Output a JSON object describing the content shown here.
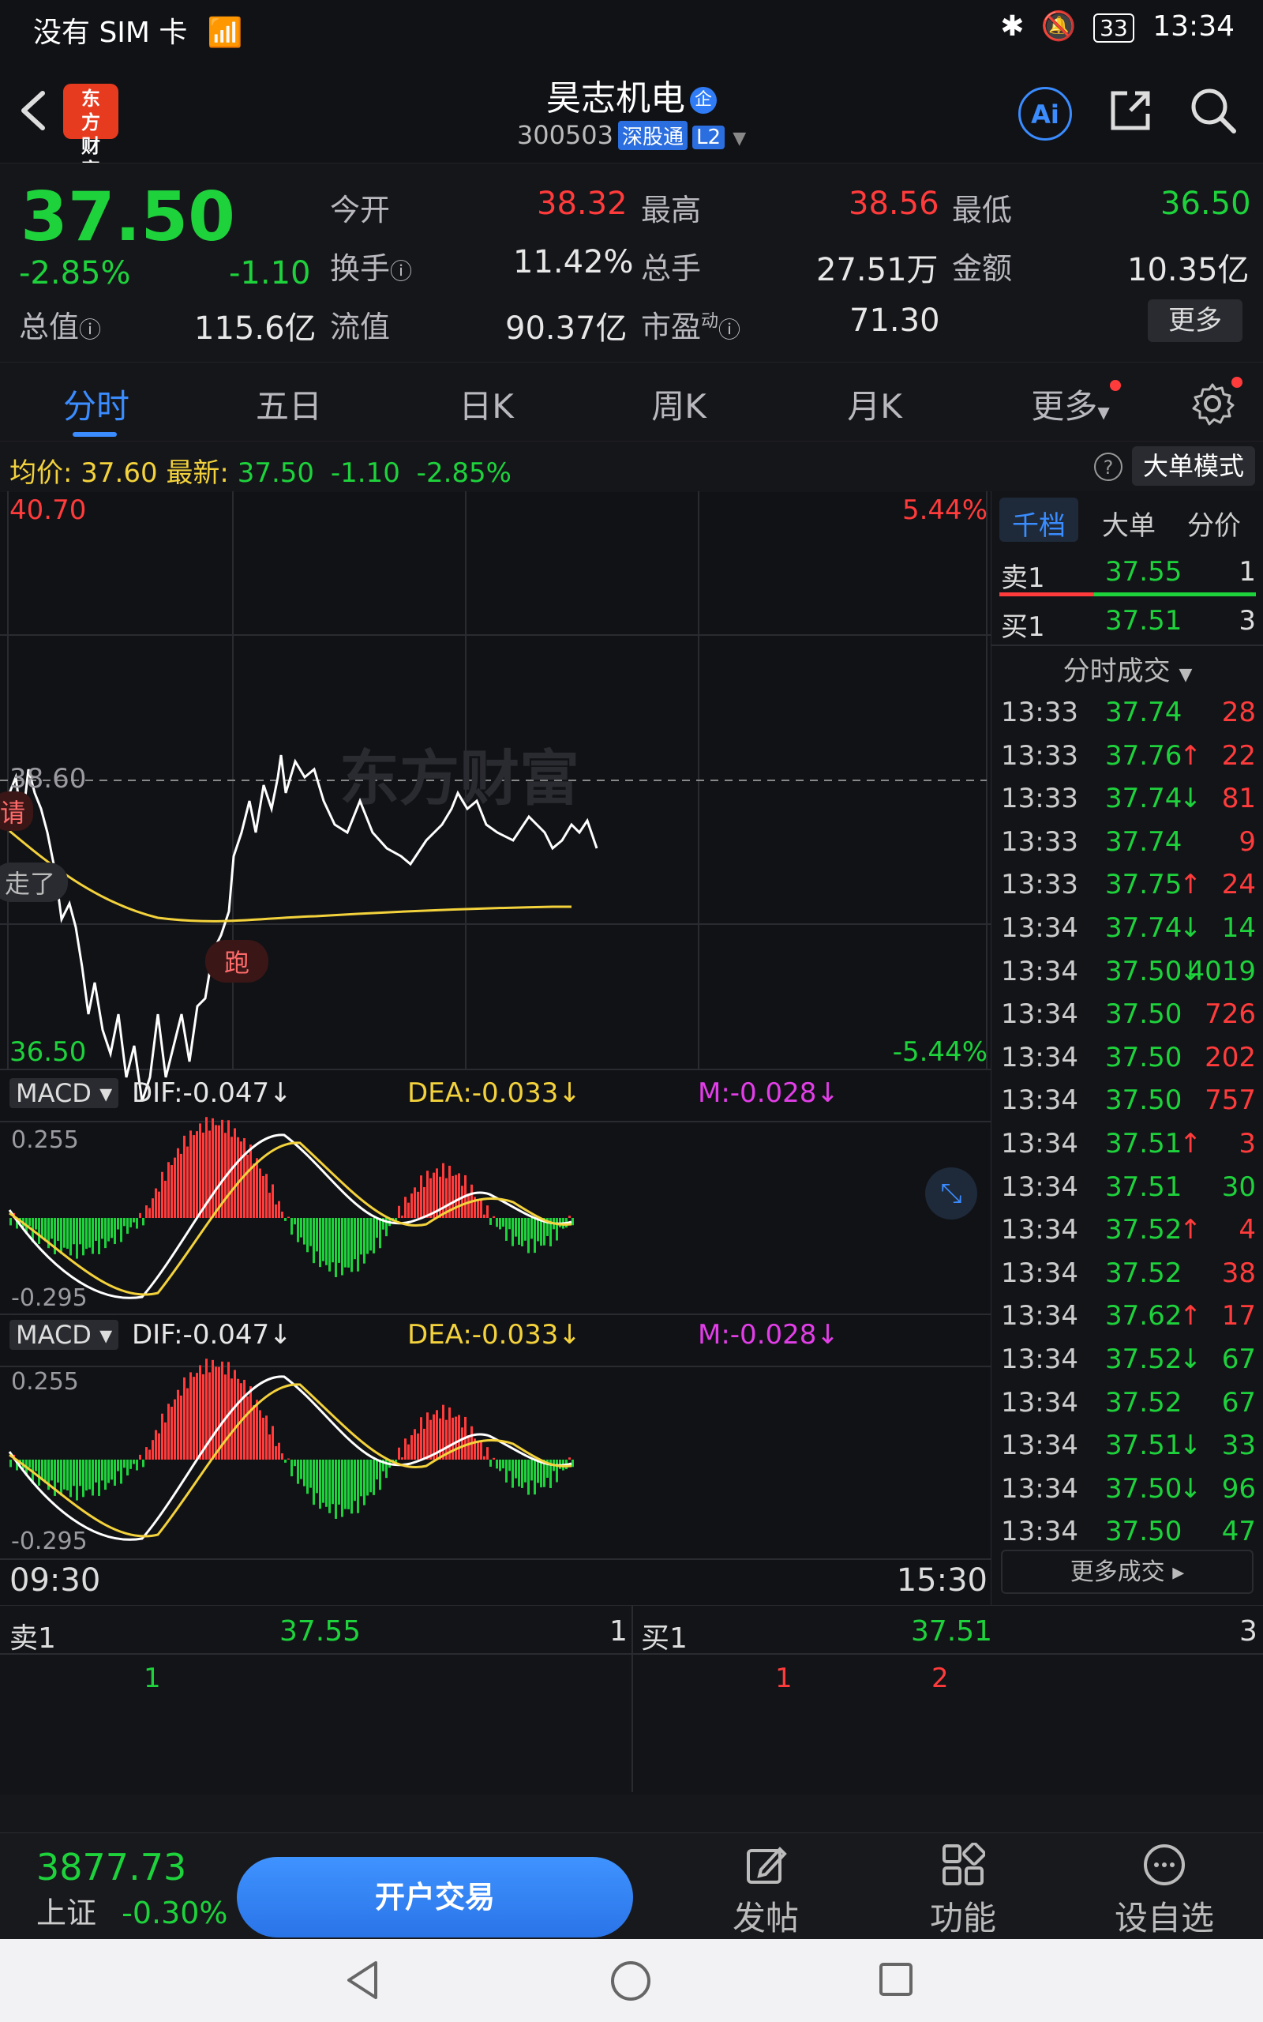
{
  "status_bar": {
    "carrier": "没有 SIM 卡",
    "battery": "33",
    "time": "13:34"
  },
  "header": {
    "back_icon": "chevron-left-icon",
    "app_logo_text": "东方财富",
    "stock_name": "昊志机电",
    "enterprise_badge": "企",
    "stock_code": "300503",
    "tag1": "深股通",
    "tag2": "L2",
    "ai_label": "Ai"
  },
  "quote": {
    "price": "37.50",
    "change_pct": "-2.85%",
    "change_abs": "-1.10",
    "open_label": "今开",
    "open_value": "38.32",
    "high_label": "最高",
    "high_value": "38.56",
    "low_label": "最低",
    "low_value": "36.50",
    "turnover_label": "换手",
    "turnover_value": "11.42%",
    "volume_label": "总手",
    "volume_value": "27.51万",
    "amount_label": "金额",
    "amount_value": "10.35亿",
    "mktcap_label": "总值",
    "mktcap_value": "115.6亿",
    "float_label": "流值",
    "float_value": "90.37亿",
    "pe_label": "市盈",
    "pe_sup": "动",
    "pe_value": "71.30",
    "more_label": "更多"
  },
  "tabs": [
    "分时",
    "五日",
    "日K",
    "周K",
    "月K",
    "更多"
  ],
  "info_line": {
    "avg_label": "均价:",
    "avg_value": "37.60",
    "latest_label": "最新:",
    "latest_value": "37.50",
    "change_abs": "-1.10",
    "change_pct": "-2.85%",
    "mode_label": "大单模式"
  },
  "main_chart": {
    "y_top": "40.70",
    "y_mid": "38.60",
    "y_bottom": "36.50",
    "pct_top": "5.44%",
    "pct_bottom": "-5.44%",
    "watermark": "东方财富",
    "bubble_1": "请",
    "bubble_2": "走了",
    "bubble_3": "跑",
    "x_start": "09:30",
    "x_end": "15:30"
  },
  "macd_panels": [
    {
      "name": "MACD",
      "dif": "DIF:-0.047",
      "dea": "DEA:-0.033",
      "m": "M:-0.028",
      "top": "0.255",
      "bottom": "-0.295"
    },
    {
      "name": "MACD",
      "dif": "DIF:-0.047",
      "dea": "DEA:-0.033",
      "m": "M:-0.028",
      "top": "0.255",
      "bottom": "-0.295"
    }
  ],
  "right_panel": {
    "tabs": [
      "千档",
      "大单",
      "分价"
    ],
    "sell1": {
      "label": "卖1",
      "price": "37.55",
      "qty": "1"
    },
    "buy1": {
      "label": "买1",
      "price": "37.51",
      "qty": "3"
    },
    "ticks_title": "分时成交",
    "trades": [
      {
        "time": "13:33",
        "price": "37.74",
        "arrow": "",
        "qty": "28",
        "dir": "up"
      },
      {
        "time": "13:33",
        "price": "37.76",
        "arrow": "↑",
        "qty": "22",
        "dir": "up"
      },
      {
        "time": "13:33",
        "price": "37.74",
        "arrow": "↓",
        "qty": "81",
        "dir": "up"
      },
      {
        "time": "13:33",
        "price": "37.74",
        "arrow": "",
        "qty": "9",
        "dir": "up"
      },
      {
        "time": "13:33",
        "price": "37.75",
        "arrow": "↑",
        "qty": "24",
        "dir": "up"
      },
      {
        "time": "13:34",
        "price": "37.74",
        "arrow": "↓",
        "qty": "14",
        "dir": "down"
      },
      {
        "time": "13:34",
        "price": "37.50",
        "arrow": "↓",
        "qty": "4019",
        "dir": "down"
      },
      {
        "time": "13:34",
        "price": "37.50",
        "arrow": "",
        "qty": "726",
        "dir": "up"
      },
      {
        "time": "13:34",
        "price": "37.50",
        "arrow": "",
        "qty": "202",
        "dir": "up"
      },
      {
        "time": "13:34",
        "price": "37.50",
        "arrow": "",
        "qty": "757",
        "dir": "up"
      },
      {
        "time": "13:34",
        "price": "37.51",
        "arrow": "↑",
        "qty": "3",
        "dir": "up"
      },
      {
        "time": "13:34",
        "price": "37.51",
        "arrow": "",
        "qty": "30",
        "dir": "down"
      },
      {
        "time": "13:34",
        "price": "37.52",
        "arrow": "↑",
        "qty": "4",
        "dir": "up"
      },
      {
        "time": "13:34",
        "price": "37.52",
        "arrow": "",
        "qty": "38",
        "dir": "up"
      },
      {
        "time": "13:34",
        "price": "37.62",
        "arrow": "↑",
        "qty": "17",
        "dir": "up"
      },
      {
        "time": "13:34",
        "price": "37.52",
        "arrow": "↓",
        "qty": "67",
        "dir": "down"
      },
      {
        "time": "13:34",
        "price": "37.52",
        "arrow": "",
        "qty": "67",
        "dir": "down"
      },
      {
        "time": "13:34",
        "price": "37.51",
        "arrow": "↓",
        "qty": "33",
        "dir": "down"
      },
      {
        "time": "13:34",
        "price": "37.50",
        "arrow": "↓",
        "qty": "96",
        "dir": "down"
      },
      {
        "time": "13:34",
        "price": "37.50",
        "arrow": "",
        "qty": "47",
        "dir": "down"
      }
    ],
    "more_trades": "更多成交"
  },
  "order_book": {
    "sell_label": "卖1",
    "sell_price": "37.55",
    "sell_qty": "1",
    "buy_label": "买1",
    "buy_price": "37.51",
    "buy_qty": "3",
    "sell_queue": [
      "1"
    ],
    "buy_queue": [
      "1",
      "2"
    ]
  },
  "bottom_bar": {
    "index_value": "3877.73",
    "index_name": "上证",
    "index_change": "-0.30%",
    "open_trade": "开户交易",
    "post": "发帖",
    "functions": "功能",
    "add_watch": "设自选"
  },
  "colors": {
    "up": "#ff3b3b",
    "down": "#1ed23c",
    "accent": "#3a8cff",
    "avg_line": "#f3d23c"
  }
}
